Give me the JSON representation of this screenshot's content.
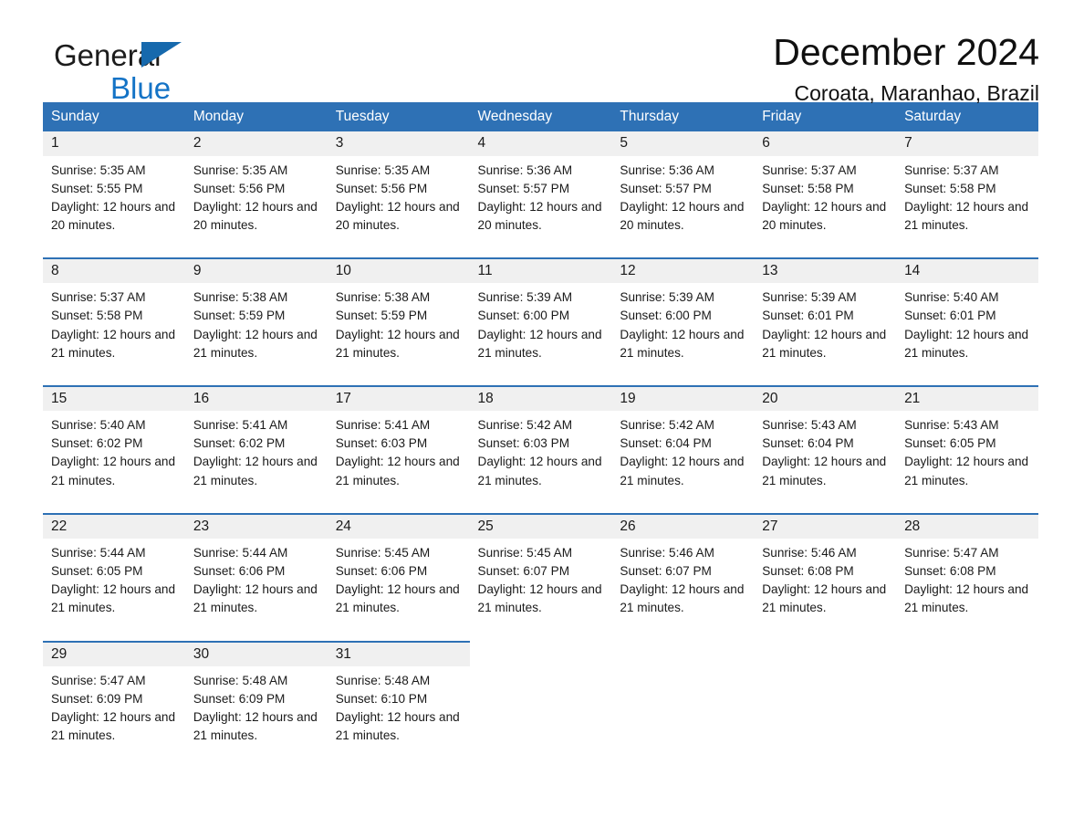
{
  "brand": {
    "word1": "General",
    "word2": "Blue",
    "triangle_color": "#1669ad",
    "blue_text_color": "#1473c6"
  },
  "header": {
    "month_title": "December 2024",
    "location": "Coroata, Maranhao, Brazil"
  },
  "theme": {
    "header_blue": "#2e71b5",
    "daynum_band": "#f0f0f0",
    "page_background": "#ffffff"
  },
  "calendar": {
    "weekday_headers": [
      "Sunday",
      "Monday",
      "Tuesday",
      "Wednesday",
      "Thursday",
      "Friday",
      "Saturday"
    ],
    "weeks": [
      [
        {
          "day": "1",
          "sunrise": "Sunrise: 5:35 AM",
          "sunset": "Sunset: 5:55 PM",
          "daylight": "Daylight: 12 hours and 20 minutes."
        },
        {
          "day": "2",
          "sunrise": "Sunrise: 5:35 AM",
          "sunset": "Sunset: 5:56 PM",
          "daylight": "Daylight: 12 hours and 20 minutes."
        },
        {
          "day": "3",
          "sunrise": "Sunrise: 5:35 AM",
          "sunset": "Sunset: 5:56 PM",
          "daylight": "Daylight: 12 hours and 20 minutes."
        },
        {
          "day": "4",
          "sunrise": "Sunrise: 5:36 AM",
          "sunset": "Sunset: 5:57 PM",
          "daylight": "Daylight: 12 hours and 20 minutes."
        },
        {
          "day": "5",
          "sunrise": "Sunrise: 5:36 AM",
          "sunset": "Sunset: 5:57 PM",
          "daylight": "Daylight: 12 hours and 20 minutes."
        },
        {
          "day": "6",
          "sunrise": "Sunrise: 5:37 AM",
          "sunset": "Sunset: 5:58 PM",
          "daylight": "Daylight: 12 hours and 20 minutes."
        },
        {
          "day": "7",
          "sunrise": "Sunrise: 5:37 AM",
          "sunset": "Sunset: 5:58 PM",
          "daylight": "Daylight: 12 hours and 21 minutes."
        }
      ],
      [
        {
          "day": "8",
          "sunrise": "Sunrise: 5:37 AM",
          "sunset": "Sunset: 5:58 PM",
          "daylight": "Daylight: 12 hours and 21 minutes."
        },
        {
          "day": "9",
          "sunrise": "Sunrise: 5:38 AM",
          "sunset": "Sunset: 5:59 PM",
          "daylight": "Daylight: 12 hours and 21 minutes."
        },
        {
          "day": "10",
          "sunrise": "Sunrise: 5:38 AM",
          "sunset": "Sunset: 5:59 PM",
          "daylight": "Daylight: 12 hours and 21 minutes."
        },
        {
          "day": "11",
          "sunrise": "Sunrise: 5:39 AM",
          "sunset": "Sunset: 6:00 PM",
          "daylight": "Daylight: 12 hours and 21 minutes."
        },
        {
          "day": "12",
          "sunrise": "Sunrise: 5:39 AM",
          "sunset": "Sunset: 6:00 PM",
          "daylight": "Daylight: 12 hours and 21 minutes."
        },
        {
          "day": "13",
          "sunrise": "Sunrise: 5:39 AM",
          "sunset": "Sunset: 6:01 PM",
          "daylight": "Daylight: 12 hours and 21 minutes."
        },
        {
          "day": "14",
          "sunrise": "Sunrise: 5:40 AM",
          "sunset": "Sunset: 6:01 PM",
          "daylight": "Daylight: 12 hours and 21 minutes."
        }
      ],
      [
        {
          "day": "15",
          "sunrise": "Sunrise: 5:40 AM",
          "sunset": "Sunset: 6:02 PM",
          "daylight": "Daylight: 12 hours and 21 minutes."
        },
        {
          "day": "16",
          "sunrise": "Sunrise: 5:41 AM",
          "sunset": "Sunset: 6:02 PM",
          "daylight": "Daylight: 12 hours and 21 minutes."
        },
        {
          "day": "17",
          "sunrise": "Sunrise: 5:41 AM",
          "sunset": "Sunset: 6:03 PM",
          "daylight": "Daylight: 12 hours and 21 minutes."
        },
        {
          "day": "18",
          "sunrise": "Sunrise: 5:42 AM",
          "sunset": "Sunset: 6:03 PM",
          "daylight": "Daylight: 12 hours and 21 minutes."
        },
        {
          "day": "19",
          "sunrise": "Sunrise: 5:42 AM",
          "sunset": "Sunset: 6:04 PM",
          "daylight": "Daylight: 12 hours and 21 minutes."
        },
        {
          "day": "20",
          "sunrise": "Sunrise: 5:43 AM",
          "sunset": "Sunset: 6:04 PM",
          "daylight": "Daylight: 12 hours and 21 minutes."
        },
        {
          "day": "21",
          "sunrise": "Sunrise: 5:43 AM",
          "sunset": "Sunset: 6:05 PM",
          "daylight": "Daylight: 12 hours and 21 minutes."
        }
      ],
      [
        {
          "day": "22",
          "sunrise": "Sunrise: 5:44 AM",
          "sunset": "Sunset: 6:05 PM",
          "daylight": "Daylight: 12 hours and 21 minutes."
        },
        {
          "day": "23",
          "sunrise": "Sunrise: 5:44 AM",
          "sunset": "Sunset: 6:06 PM",
          "daylight": "Daylight: 12 hours and 21 minutes."
        },
        {
          "day": "24",
          "sunrise": "Sunrise: 5:45 AM",
          "sunset": "Sunset: 6:06 PM",
          "daylight": "Daylight: 12 hours and 21 minutes."
        },
        {
          "day": "25",
          "sunrise": "Sunrise: 5:45 AM",
          "sunset": "Sunset: 6:07 PM",
          "daylight": "Daylight: 12 hours and 21 minutes."
        },
        {
          "day": "26",
          "sunrise": "Sunrise: 5:46 AM",
          "sunset": "Sunset: 6:07 PM",
          "daylight": "Daylight: 12 hours and 21 minutes."
        },
        {
          "day": "27",
          "sunrise": "Sunrise: 5:46 AM",
          "sunset": "Sunset: 6:08 PM",
          "daylight": "Daylight: 12 hours and 21 minutes."
        },
        {
          "day": "28",
          "sunrise": "Sunrise: 5:47 AM",
          "sunset": "Sunset: 6:08 PM",
          "daylight": "Daylight: 12 hours and 21 minutes."
        }
      ],
      [
        {
          "day": "29",
          "sunrise": "Sunrise: 5:47 AM",
          "sunset": "Sunset: 6:09 PM",
          "daylight": "Daylight: 12 hours and 21 minutes."
        },
        {
          "day": "30",
          "sunrise": "Sunrise: 5:48 AM",
          "sunset": "Sunset: 6:09 PM",
          "daylight": "Daylight: 12 hours and 21 minutes."
        },
        {
          "day": "31",
          "sunrise": "Sunrise: 5:48 AM",
          "sunset": "Sunset: 6:10 PM",
          "daylight": "Daylight: 12 hours and 21 minutes."
        },
        null,
        null,
        null,
        null
      ]
    ]
  }
}
